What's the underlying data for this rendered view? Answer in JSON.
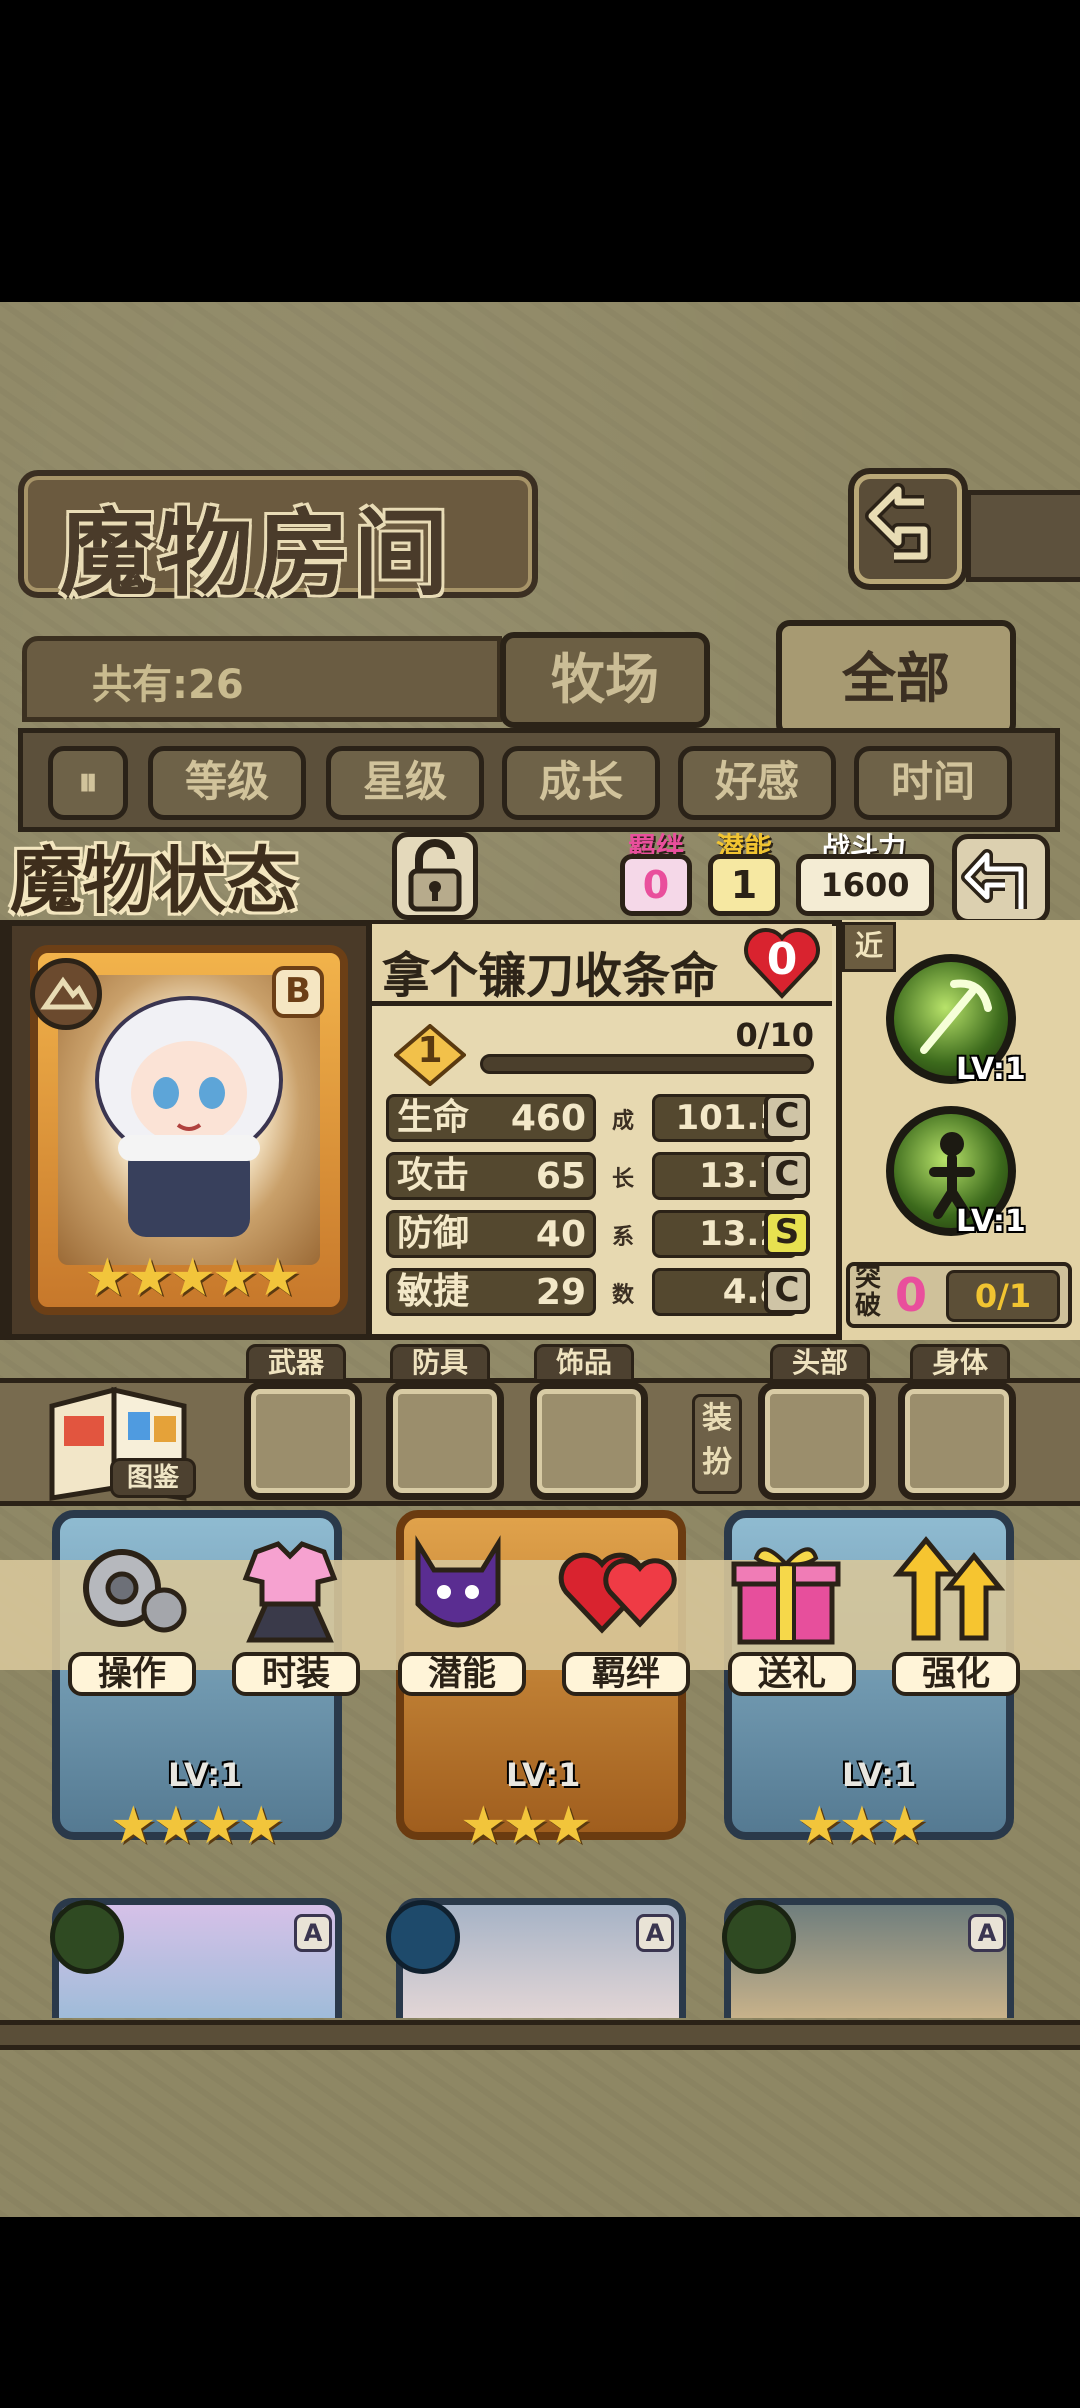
{
  "header": {
    "title": "魔物房间"
  },
  "collection": {
    "count_text": "共有:26"
  },
  "tabs": [
    {
      "label": "牧场"
    },
    {
      "label": "全部"
    }
  ],
  "sort_buttons": [
    {
      "label": "等级"
    },
    {
      "label": "星级"
    },
    {
      "label": "成长"
    },
    {
      "label": "好感"
    },
    {
      "label": "时间"
    }
  ],
  "status": {
    "title": "魔物状态",
    "bond_label": "羁绊",
    "bond_value": "0",
    "potential_label": "潜能",
    "potential_value": "1",
    "power_label": "战斗力",
    "power_value": "1600"
  },
  "monster": {
    "name": "拿个镰刀收条命",
    "rank": "B",
    "affection": "0",
    "level": "1",
    "exp": "0/10",
    "exp_fraction": 0,
    "stars": 5,
    "stats": [
      {
        "label": "生命",
        "value": "460",
        "growth": "101.5",
        "grade": "C"
      },
      {
        "label": "攻击",
        "value": "65",
        "growth": "13.7",
        "grade": "C"
      },
      {
        "label": "防御",
        "value": "40",
        "growth": "13.2",
        "grade": "S"
      },
      {
        "label": "敏捷",
        "value": "29",
        "growth": "4.8",
        "grade": "C"
      }
    ],
    "growth_vertical": [
      "成",
      "长",
      "系",
      "数"
    ]
  },
  "skills": {
    "range_label": "近",
    "items": [
      {
        "level": "LV:1"
      },
      {
        "level": "LV:1"
      }
    ],
    "breakthrough_label": [
      "突",
      "破"
    ],
    "breakthrough_value": "0",
    "breakthrough_progress": "0/1"
  },
  "equipment": {
    "book_label": "图鉴",
    "slots": [
      {
        "label": "武器"
      },
      {
        "label": "防具"
      },
      {
        "label": "饰品"
      },
      {
        "label": "头部"
      },
      {
        "label": "身体"
      }
    ],
    "dress_label": [
      "装",
      "扮"
    ]
  },
  "actions": [
    {
      "label": "操作",
      "icon": "gear-icon"
    },
    {
      "label": "时装",
      "icon": "outfit-icon"
    },
    {
      "label": "潜能",
      "icon": "demon-icon"
    },
    {
      "label": "羁绊",
      "icon": "hearts-icon"
    },
    {
      "label": "送礼",
      "icon": "gift-icon"
    },
    {
      "label": "强化",
      "icon": "upgrade-arrows-icon"
    }
  ],
  "roster": [
    {
      "level": "LV:1",
      "stars": 4
    },
    {
      "level": "LV:1",
      "stars": 3
    },
    {
      "level": "LV:1",
      "stars": 3
    }
  ],
  "roster_row2_ranks": [
    "A",
    "A",
    "A"
  ],
  "colors": {
    "accent_pink": "#e94f9c",
    "badge_yellow": "#f1c431",
    "grade_s": "#e7e150",
    "heart_red": "#d9232f"
  }
}
